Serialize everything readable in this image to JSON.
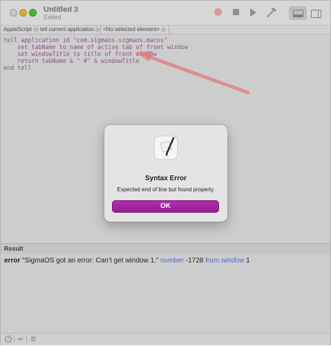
{
  "titlebar": {
    "title": "Untitled 3",
    "subtitle": "Edited"
  },
  "navbar": {
    "language": "AppleScript ◇",
    "target": "tell current application ◇",
    "element": "<No selected element> ◇"
  },
  "editor": {
    "code": "tell application id \"com.sigmaos.sigmaos.macos\"\n    set tabName to name of active tab of front window\n    set windowTitle to title of front window\n    return tabName & \" #\" & windowTitle\nend tell"
  },
  "result": {
    "header": "Result",
    "error_word": "error",
    "message": " \"SigmaOS got an error: Can’t get window 1.\" ",
    "number_word": "number",
    "code": " -1728 ",
    "from_word": "from",
    "space": " ",
    "window_word": "window",
    "index": " 1"
  },
  "dialog": {
    "title": "Syntax Error",
    "message": "Expected end of line but found property.",
    "button": "OK"
  },
  "colors": {
    "accent": "#a626a2",
    "code_text": "#8a4f86",
    "keyword_blue": "#5367c9",
    "arrow": "#e07a7a"
  },
  "icons": {
    "record": "record-icon",
    "stop": "stop-icon",
    "run": "run-icon",
    "compile": "hammer-icon"
  }
}
